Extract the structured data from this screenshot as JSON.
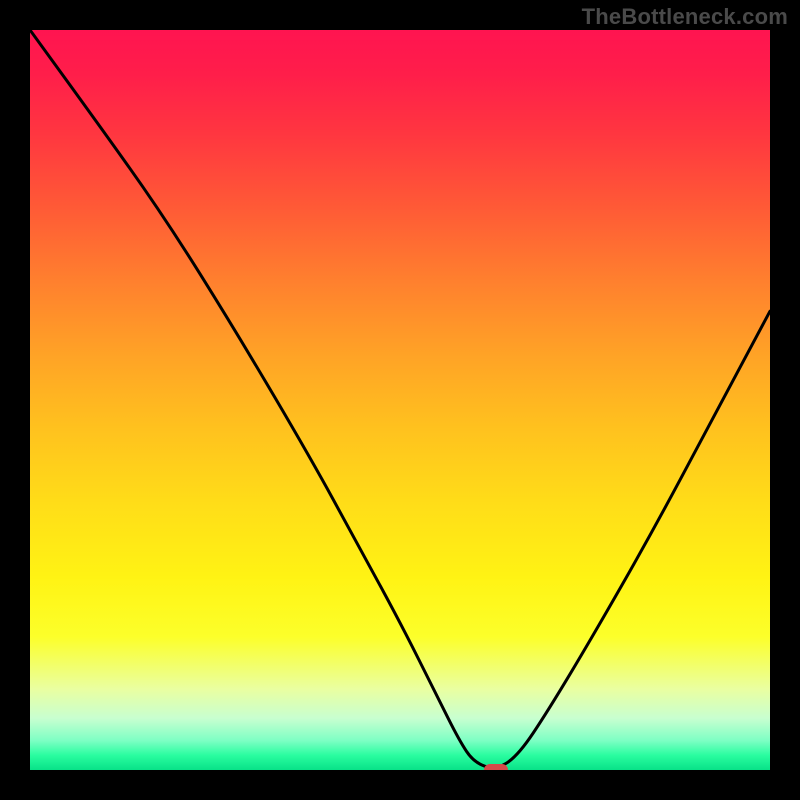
{
  "watermark": "TheBottleneck.com",
  "chart_data": {
    "type": "line",
    "title": "",
    "xlabel": "",
    "ylabel": "",
    "xlim": [
      0,
      100
    ],
    "ylim": [
      0,
      100
    ],
    "grid": false,
    "x": [
      0,
      8,
      18,
      28,
      38,
      44,
      50,
      55,
      58,
      60,
      63,
      66,
      70,
      76,
      84,
      92,
      100
    ],
    "values": [
      100,
      89,
      75,
      59,
      42,
      31,
      20,
      10,
      4,
      1,
      0,
      2,
      8,
      18,
      32,
      47,
      62
    ],
    "marker": {
      "x": 63,
      "y": 0
    },
    "gradient_stops": [
      {
        "pos": 0,
        "color": "#ff1450"
      },
      {
        "pos": 14,
        "color": "#ff3640"
      },
      {
        "pos": 34,
        "color": "#ff802e"
      },
      {
        "pos": 54,
        "color": "#ffc21e"
      },
      {
        "pos": 74,
        "color": "#fff314"
      },
      {
        "pos": 89,
        "color": "#eaffa0"
      },
      {
        "pos": 96,
        "color": "#7effc4"
      },
      {
        "pos": 100,
        "color": "#08e288"
      }
    ]
  }
}
